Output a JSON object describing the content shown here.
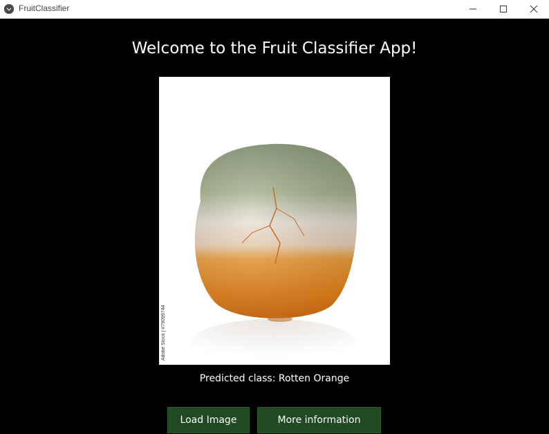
{
  "window": {
    "title": "FruitClassifier",
    "app_icon": "kivy-logo-icon",
    "controls": [
      "minimize-icon",
      "maximize-icon",
      "close-icon"
    ]
  },
  "main": {
    "welcome_text": "Welcome to the Fruit Classifier App!",
    "image": {
      "subject": "rotten orange",
      "watermark_text": "Adobe Stock | #79099744"
    },
    "prediction_text": "Predicted class: Rotten Orange",
    "buttons": {
      "load_label": "Load Image",
      "info_label": "More information"
    }
  },
  "colors": {
    "background": "#000000",
    "button_bg": "#1f4a22",
    "text": "#ffffff"
  }
}
